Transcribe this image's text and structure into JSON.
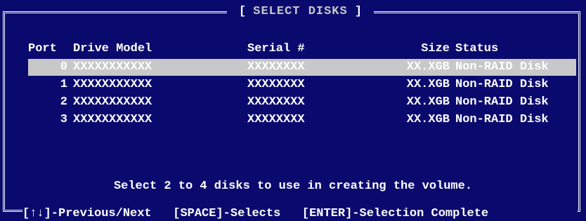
{
  "title": {
    "bracket_open": "[",
    "text": "SELECT DISKS",
    "bracket_close": "]"
  },
  "table": {
    "headers": {
      "port": "Port",
      "model": "Drive Model",
      "serial": "Serial #",
      "size": "Size",
      "status": "Status"
    },
    "rows": [
      {
        "port": "0",
        "model": "XXXXXXXXXXX",
        "serial": "XXXXXXXX",
        "size": "XX.XGB",
        "status": "Non-RAID Disk"
      },
      {
        "port": "1",
        "model": "XXXXXXXXXXX",
        "serial": "XXXXXXXX",
        "size": "XX.XGB",
        "status": "Non-RAID Disk"
      },
      {
        "port": "2",
        "model": "XXXXXXXXXXX",
        "serial": "XXXXXXXX",
        "size": "XX.XGB",
        "status": "Non-RAID Disk"
      },
      {
        "port": "3",
        "model": "XXXXXXXXXXX",
        "serial": "XXXXXXXX",
        "size": "XX.XGB",
        "status": "Non-RAID Disk"
      }
    ],
    "selected_index": 0
  },
  "hint": "Select 2 to 4 disks to use in creating the volume.",
  "footer": {
    "nav": "[↑↓]-Previous/Next",
    "space": "[SPACE]-Selects",
    "enter": "[ENTER]-Selection Complete"
  },
  "colors": {
    "background": "#0a0a6e",
    "highlight": "#c8c8c8",
    "text": "#ffffff"
  }
}
